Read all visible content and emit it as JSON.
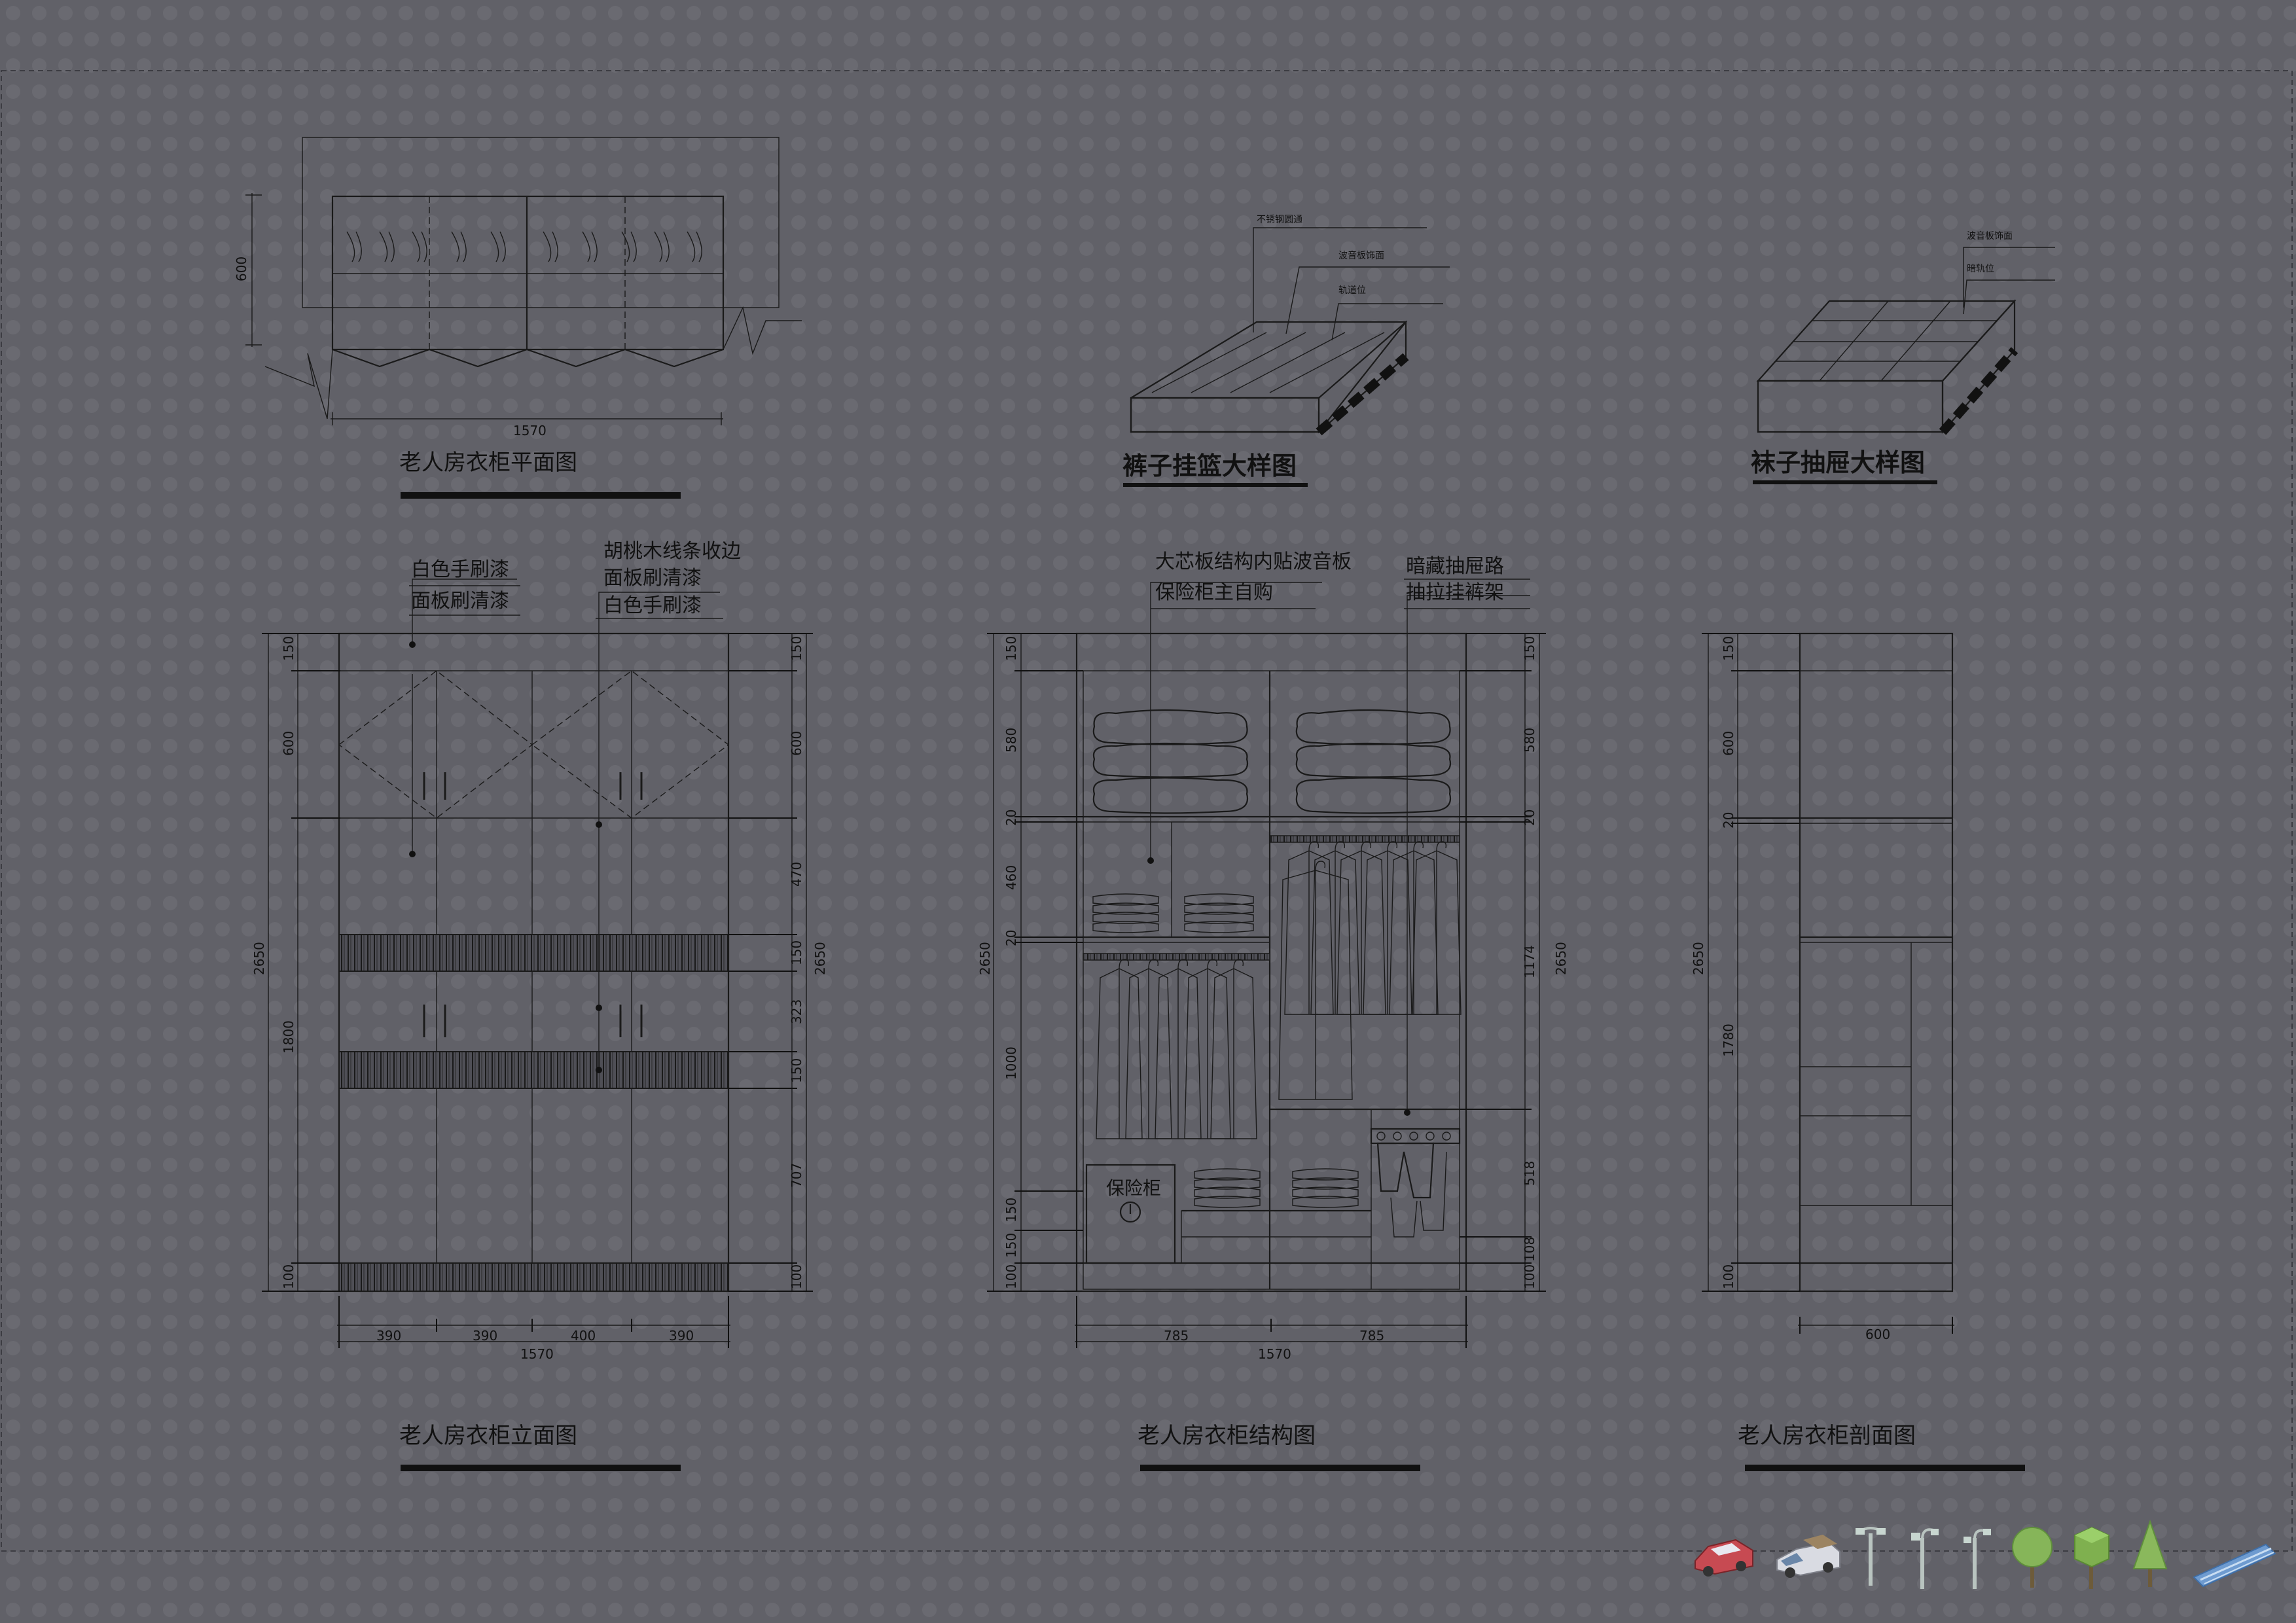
{
  "drawings": {
    "plan": {
      "title": "老人房衣柜平面图",
      "width_dim": "1570",
      "depth_dim": "600"
    },
    "pants_basket": {
      "title": "裤子挂篮大样图",
      "notes": [
        "不锈钢圆通",
        "波音板饰面",
        "轨道位"
      ]
    },
    "sock_drawer": {
      "title": "袜子抽屉大样图",
      "notes": [
        "波音板饰面",
        "暗轨位"
      ]
    },
    "elevation": {
      "title": "老人房衣柜立面图",
      "left_notes": [
        "白色手刷漆",
        "面板刷清漆"
      ],
      "right_notes": [
        "胡桃木线条收边",
        "面板刷清漆",
        "白色手刷漆"
      ],
      "left_dims": [
        "150",
        "600",
        "1800",
        "100"
      ],
      "left_total": "2650",
      "right_dims": [
        "150",
        "600",
        "470",
        "150",
        "323",
        "150",
        "707",
        "100"
      ],
      "right_total": "2650",
      "bottom_dims": [
        "390",
        "390",
        "400",
        "390"
      ],
      "bottom_total": "1570"
    },
    "structure": {
      "title": "老人房衣柜结构图",
      "notes_left": [
        "大芯板结构内贴波音板",
        "保险柜主自购"
      ],
      "notes_right": [
        "暗藏抽屉路",
        "抽拉挂裤架"
      ],
      "safe_label": "保险柜",
      "left_dims": [
        "150",
        "580",
        "20",
        "460",
        "20",
        "1000",
        "150",
        "150",
        "100"
      ],
      "left_total": "2650",
      "right_dims": [
        "150",
        "580",
        "20",
        "1174",
        "518",
        "108",
        "100"
      ],
      "right_total": "2650",
      "bottom_dims": [
        "785",
        "785"
      ],
      "bottom_total": "1570"
    },
    "section": {
      "title": "老人房衣柜剖面图",
      "left_dims": [
        "150",
        "600",
        "20",
        "1780",
        "100"
      ],
      "left_total": "2650",
      "bottom_dim": "600"
    }
  },
  "toolbar_icons": [
    "car-icon",
    "van-icon",
    "street-lamp-double-icon",
    "street-lamp-single-icon",
    "street-lamp-triple-icon",
    "round-tree-icon",
    "cube-tree-icon",
    "cone-tree-icon",
    "glass-panel-icon"
  ],
  "colors": {
    "background": "#616168",
    "line": "#1a1a1a"
  }
}
